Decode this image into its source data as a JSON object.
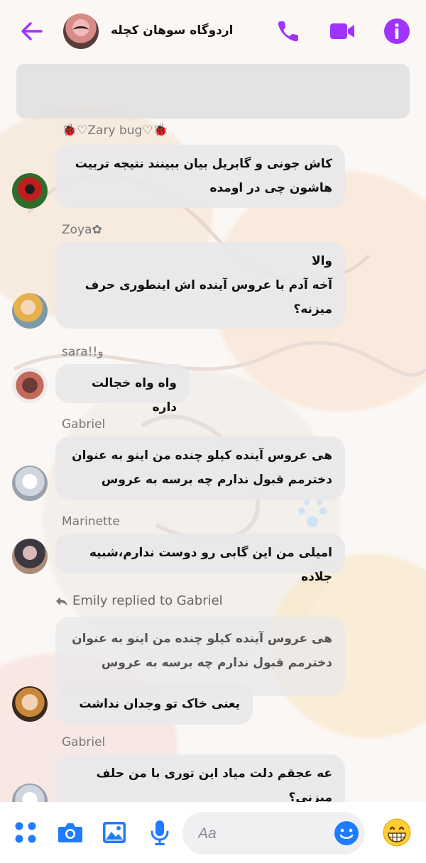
{
  "header": {
    "title": "اردوگاه سوهان کچله"
  },
  "colors": {
    "accent": "#a033ff",
    "blue": "#1f7cff",
    "bubble": "#e8e8ea"
  },
  "messages": [
    {
      "sender": "🐞♡Zary bug♡🐞",
      "text": "کاش جونی و گابریل بیان ببینند نتیجه تربیت\nهاشون چی در اومده"
    },
    {
      "sender": "Zoya✿",
      "text": "والا\nآخه آدم با عروس آینده اش اینطوری حرف\nمیزنه؟"
    },
    {
      "sender": "sara!!و",
      "text": "واه واه خجالت داره"
    },
    {
      "sender": "Gabriel",
      "text": "هی عروس آینده کیلو چنده من اینو به عنوان\nدخترمم قبول ندارم چه برسه به عروس"
    },
    {
      "sender": "Marinette",
      "text": "امیلی من این گابی رو دوست ندارم،شبیه جلاده"
    },
    {
      "reply_label": "Emily replied to Gabriel",
      "quoted": "هی عروس آینده کیلو چنده من اینو به عنوان\nدخترمم قبول ندارم چه برسه به عروس",
      "text": "یعنی خاک  تو  وجدان نداشت"
    },
    {
      "sender": "Gabriel",
      "text": "عه عجقم دلت میاد این توری با من حلف\nمیزنی؟"
    }
  ],
  "composer": {
    "placeholder": "Aa"
  },
  "icons": {
    "back": "back-arrow-icon",
    "call": "phone-icon",
    "video": "video-camera-icon",
    "info": "info-icon",
    "apps": "apps-grid-icon",
    "camera": "camera-icon",
    "gallery": "gallery-icon",
    "mic": "microphone-icon",
    "emoji": "emoji-icon",
    "reaction": "grinning-face-icon"
  }
}
